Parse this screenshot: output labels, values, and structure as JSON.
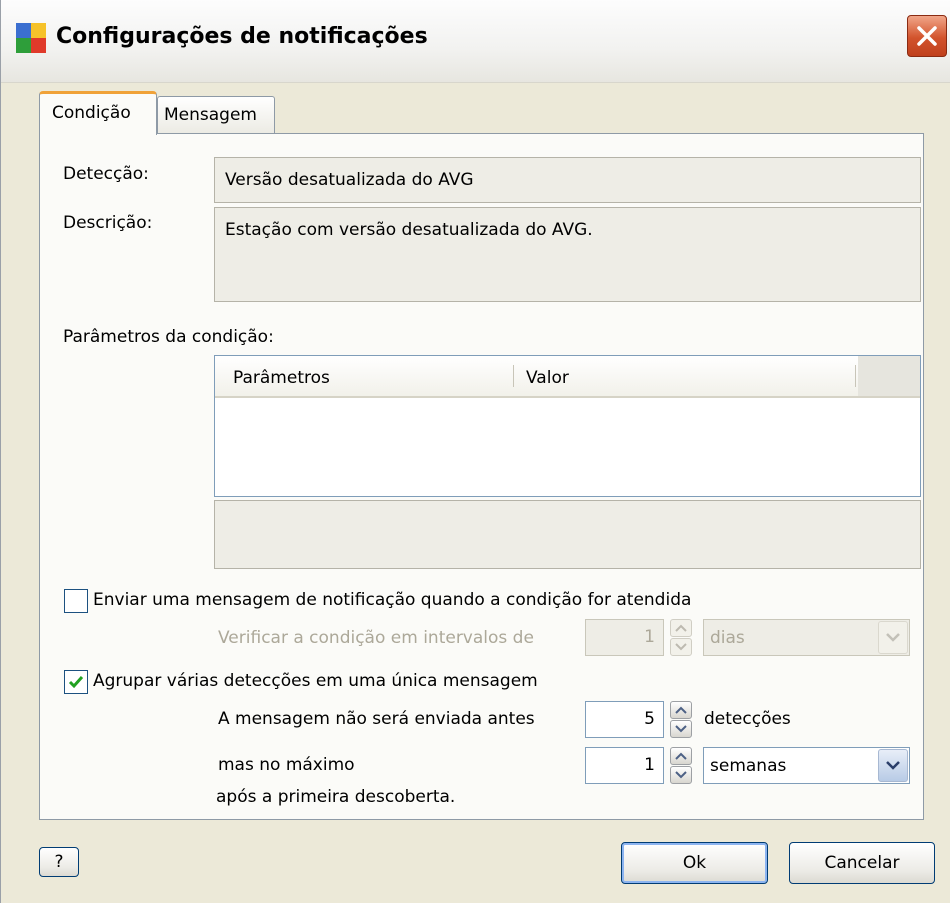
{
  "window": {
    "title": "Configurações de notificações"
  },
  "tabs": [
    {
      "label": "Condição",
      "active": true
    },
    {
      "label": "Mensagem",
      "active": false
    }
  ],
  "condition": {
    "detection_label": "Detecção:",
    "detection_value": "Versão desatualizada do AVG",
    "description_label": "Descrição:",
    "description_value": "Estação com versão desatualizada do AVG.",
    "params_label": "Parâmetros da condição:",
    "table": {
      "columns": [
        "Parâmetros",
        "Valor"
      ],
      "rows": []
    }
  },
  "send_notification": {
    "label": "Enviar uma mensagem de notificação quando a condição for atendida",
    "checked": false,
    "interval_label": "Verificar a condição em intervalos de",
    "interval_value": "1",
    "interval_unit": "dias"
  },
  "group_detections": {
    "label": "Agrupar várias detecções em uma única mensagem",
    "checked": true,
    "min_label": "A mensagem não será enviada antes",
    "min_value": "5",
    "min_unit": "detecções",
    "max_label": "mas no máximo",
    "max_value": "1",
    "max_unit": "semanas",
    "after_label": "após a primeira descoberta."
  },
  "buttons": {
    "help": "?",
    "ok": "Ok",
    "cancel": "Cancelar"
  },
  "icons": {
    "app": "avg-app-icon",
    "close": "close-icon",
    "spin_up": "arrow-up-icon",
    "spin_down": "arrow-down-icon",
    "dropdown": "chevron-down-icon",
    "check": "checkmark-icon"
  },
  "colors": {
    "tab_accent": "#f0a238",
    "close_button": "#d2532c",
    "input_border": "#7f9db9"
  }
}
